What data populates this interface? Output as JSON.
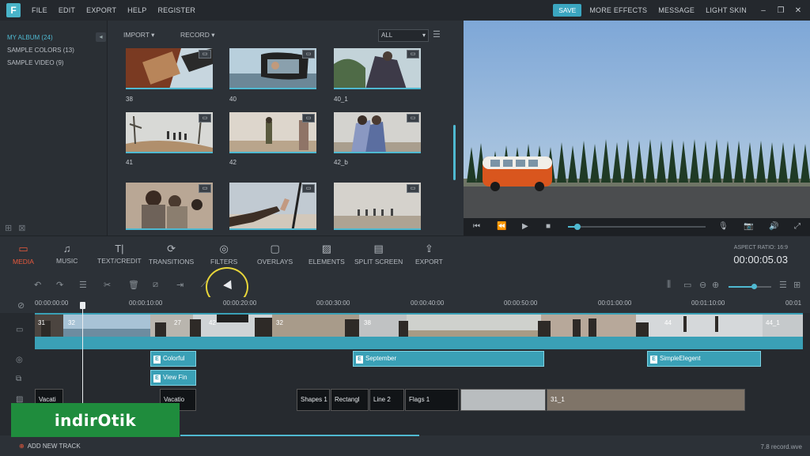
{
  "app": {
    "logo_letter": "F"
  },
  "menu": {
    "items": [
      "FILE",
      "EDIT",
      "EXPORT",
      "HELP",
      "REGISTER"
    ]
  },
  "menu_right": {
    "save": "SAVE",
    "more_effects": "MORE EFFECTS",
    "message": "MESSAGE",
    "light_skin": "LIGHT SKIN"
  },
  "library": {
    "items": [
      "MY ALBUM (24)",
      "SAMPLE COLORS (13)",
      "SAMPLE VIDEO (9)"
    ]
  },
  "media_toolbar": {
    "import": "IMPORT",
    "record": "RECORD",
    "filter": "ALL"
  },
  "media_items": [
    {
      "label": "38"
    },
    {
      "label": "40"
    },
    {
      "label": "40_1"
    },
    {
      "label": "41"
    },
    {
      "label": "42"
    },
    {
      "label": "42_b"
    },
    {
      "label": ""
    },
    {
      "label": ""
    },
    {
      "label": ""
    }
  ],
  "functions": [
    "MEDIA",
    "MUSIC",
    "TEXT/CREDIT",
    "TRANSITIONS",
    "FILTERS",
    "OVERLAYS",
    "ELEMENTS",
    "SPLIT SCREEN",
    "EXPORT"
  ],
  "active_function": "MEDIA",
  "status": {
    "aspect_ratio": "ASPECT RATIO: 16:9",
    "timecode": "00:00:05.03"
  },
  "ruler": [
    "00:00:00:00",
    "00:00:10:00",
    "00:00:20:00",
    "00:00:30:00",
    "00:00:40:00",
    "00:00:50:00",
    "00:01:00:00",
    "00:01:10:00",
    "00:01"
  ],
  "video_clips": [
    "31",
    "32",
    "27",
    "42",
    "32",
    "38",
    "44",
    "44_1"
  ],
  "text_clips": [
    "Colorful",
    "September",
    "SimpleElegent",
    "View Fin"
  ],
  "pip_clips": [
    "Vacati",
    "Vacatio",
    "Shapes 1",
    "Rectangl",
    "Line 2",
    "Flags 1",
    "31_1"
  ],
  "bottom": {
    "add_track": "ADD NEW TRACK",
    "project_name": "7.8 record.wve"
  },
  "watermark": {
    "text": "indirOtik"
  },
  "colors": {
    "accent": "#4fb9d1",
    "active": "#e8593c",
    "highlight": "#e7d53a",
    "watermark": "#1f8c3d"
  }
}
